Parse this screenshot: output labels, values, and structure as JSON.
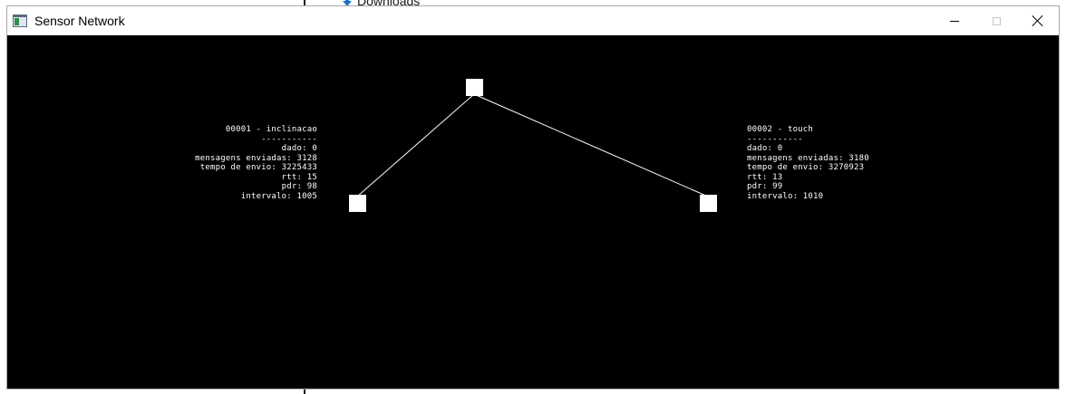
{
  "background": {
    "explorer_item": "Downloads"
  },
  "window": {
    "title": "Sensor Network",
    "controls": {
      "minimize": "—",
      "maximize": "☐",
      "close": "✕"
    }
  },
  "network": {
    "sensors": [
      {
        "id_line": "00001 - inclinacao",
        "separator": "-----------",
        "dado": "dado: 0",
        "mensagens": "mensagens enviadas: 3128",
        "tempo": "tempo de envio: 3225433",
        "rtt": "rtt: 15",
        "pdr": "pdr: 98",
        "intervalo": "intervalo: 1005"
      },
      {
        "id_line": "00002 - touch",
        "separator": "-----------",
        "dado": "dado: 0",
        "mensagens": "mensagens enviadas: 3180",
        "tempo": "tempo de envio: 3270923",
        "rtt": "rtt: 13",
        "pdr": "pdr: 99",
        "intervalo": "intervalo: 1010"
      }
    ]
  },
  "colors": {
    "canvas_bg": "#000000",
    "node": "#ffffff",
    "link": "#ffffff",
    "titlebar": "#ffffff"
  }
}
